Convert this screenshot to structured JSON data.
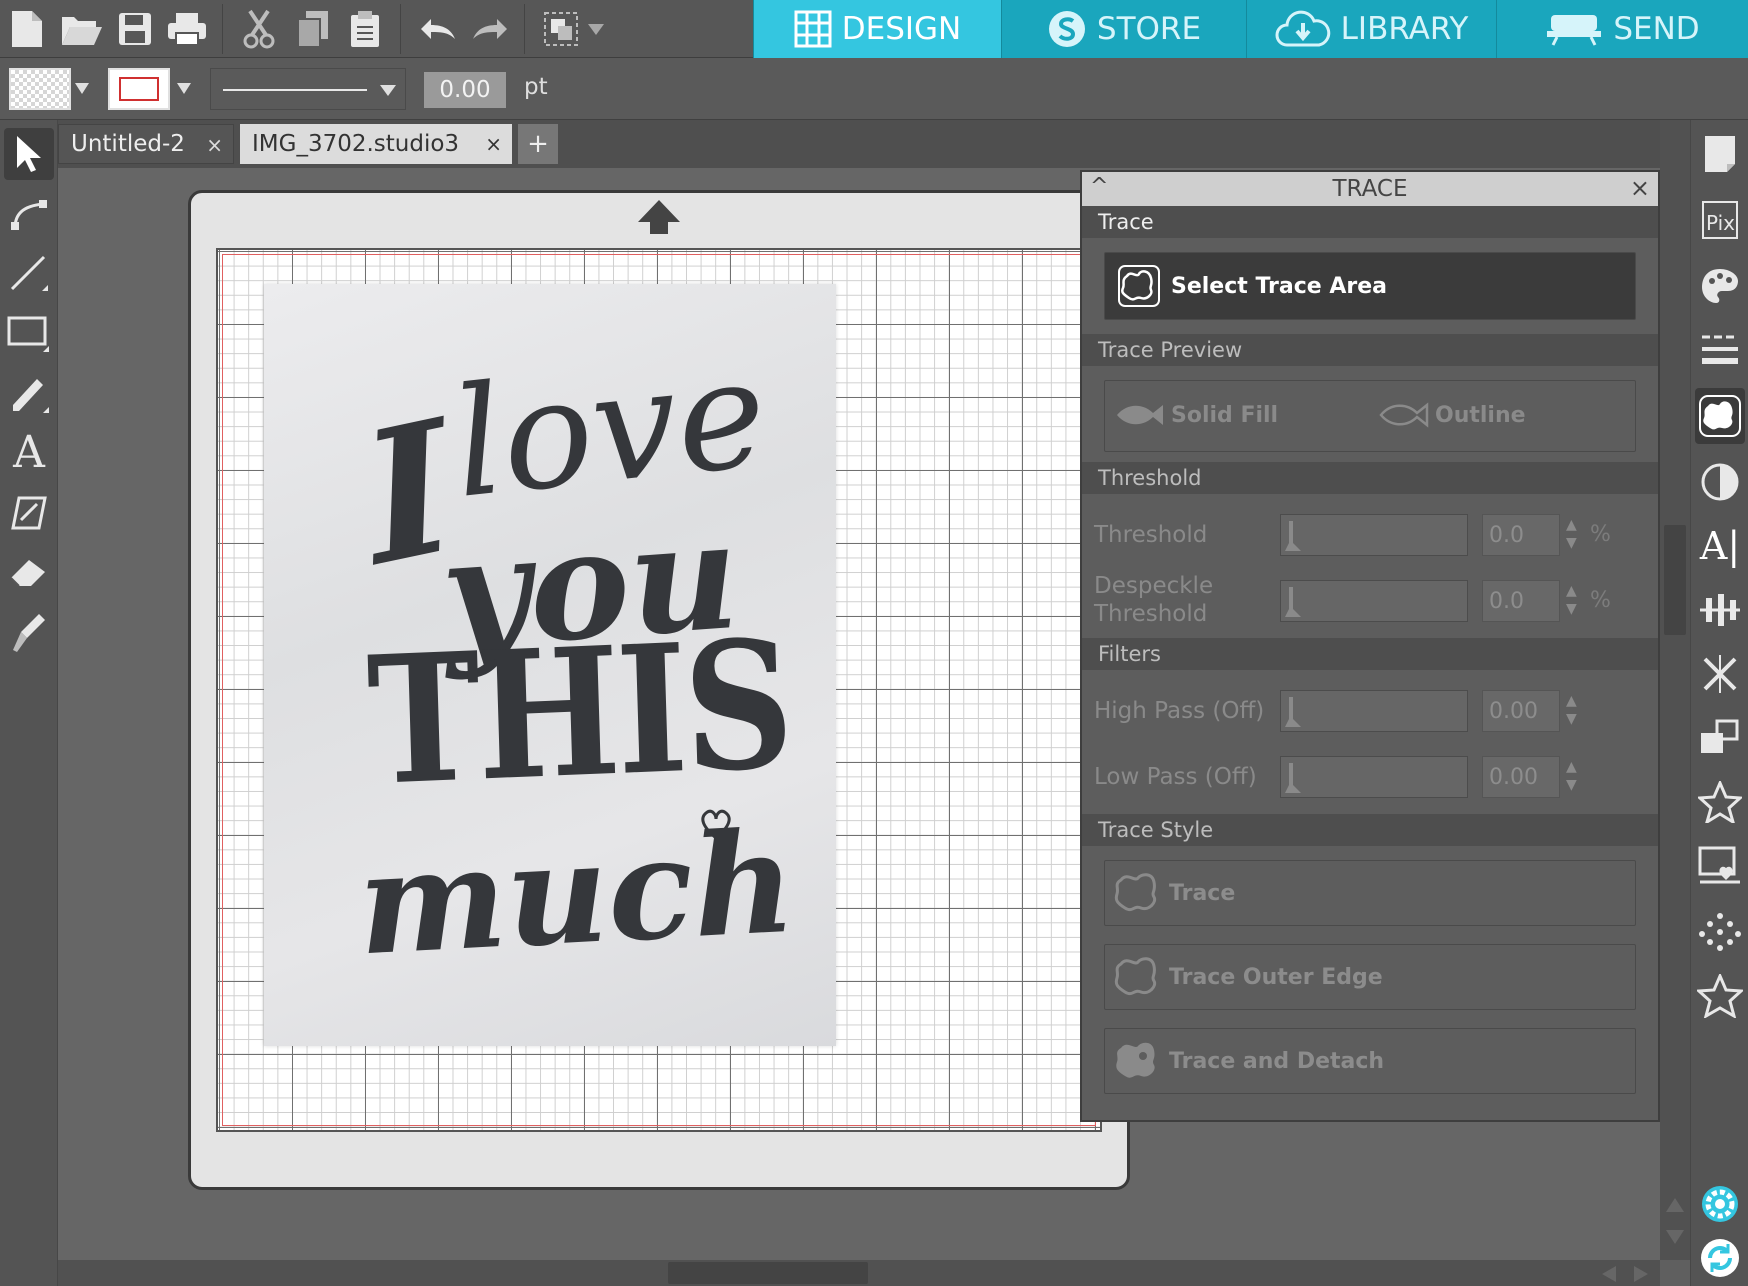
{
  "toolbar": {
    "icons": [
      "new-document-icon",
      "open-folder-icon",
      "save-icon",
      "print-icon",
      "cut-icon",
      "copy-icon",
      "paste-icon",
      "undo-icon",
      "redo-icon",
      "group-icon"
    ]
  },
  "nav": {
    "design": "DESIGN",
    "store": "STORE",
    "library": "LIBRARY",
    "send": "SEND"
  },
  "props": {
    "line_width": "0.00",
    "unit": "pt"
  },
  "tabs": [
    {
      "label": "Untitled-2",
      "close": "×"
    },
    {
      "label": "IMG_3702.studio3",
      "close": "×"
    },
    {
      "label": "+"
    }
  ],
  "lettering": {
    "line1a": "I",
    "line1b": "love",
    "line2": "you",
    "line3": "THIS",
    "line4": "much"
  },
  "trace_panel": {
    "title": "TRACE",
    "collapse": "^",
    "close": "×",
    "section_trace": "Trace",
    "select_trace_area": "Select Trace Area",
    "section_preview": "Trace Preview",
    "solid_fill": "Solid Fill",
    "outline": "Outline",
    "section_threshold": "Threshold",
    "threshold_label": "Threshold",
    "threshold_value": "0.0",
    "despeckle_line1": "Despeckle",
    "despeckle_line2": "Threshold",
    "despeckle_value": "0.0",
    "percent": "%",
    "section_filters": "Filters",
    "high_pass_label": "High Pass (Off)",
    "high_pass_value": "0.00",
    "low_pass_label": "Low Pass (Off)",
    "low_pass_value": "0.00",
    "section_style": "Trace Style",
    "trace": "Trace",
    "trace_outer_edge": "Trace Outer Edge",
    "trace_and_detach": "Trace and Detach"
  },
  "colors": {
    "accent": "#34c6e0",
    "nav_bg": "#1aa6bd"
  }
}
